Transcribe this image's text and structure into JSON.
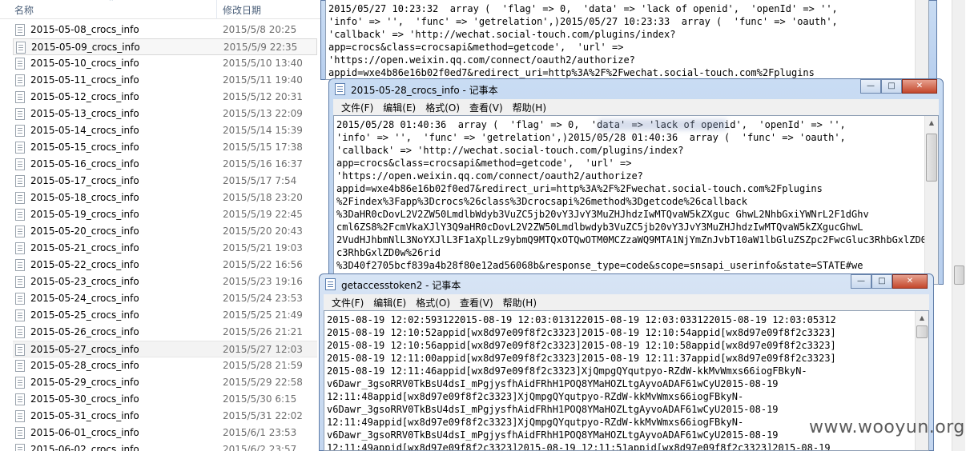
{
  "explorer": {
    "columns": {
      "name": "名称",
      "modified": "修改日期"
    },
    "files": [
      {
        "name": "2015-05-08_crocs_info",
        "date": "2015/5/8 20:25"
      },
      {
        "name": "2015-05-09_crocs_info",
        "date": "2015/5/9 22:35"
      },
      {
        "name": "2015-05-10_crocs_info",
        "date": "2015/5/10 13:40"
      },
      {
        "name": "2015-05-11_crocs_info",
        "date": "2015/5/11 19:40"
      },
      {
        "name": "2015-05-12_crocs_info",
        "date": "2015/5/12 20:31"
      },
      {
        "name": "2015-05-13_crocs_info",
        "date": "2015/5/13 22:09"
      },
      {
        "name": "2015-05-14_crocs_info",
        "date": "2015/5/14 15:39"
      },
      {
        "name": "2015-05-15_crocs_info",
        "date": "2015/5/15 17:38"
      },
      {
        "name": "2015-05-16_crocs_info",
        "date": "2015/5/16 16:37"
      },
      {
        "name": "2015-05-17_crocs_info",
        "date": "2015/5/17 7:54"
      },
      {
        "name": "2015-05-18_crocs_info",
        "date": "2015/5/18 23:20"
      },
      {
        "name": "2015-05-19_crocs_info",
        "date": "2015/5/19 22:45"
      },
      {
        "name": "2015-05-20_crocs_info",
        "date": "2015/5/20 20:43"
      },
      {
        "name": "2015-05-21_crocs_info",
        "date": "2015/5/21 19:03"
      },
      {
        "name": "2015-05-22_crocs_info",
        "date": "2015/5/22 16:56"
      },
      {
        "name": "2015-05-23_crocs_info",
        "date": "2015/5/23 19:16"
      },
      {
        "name": "2015-05-24_crocs_info",
        "date": "2015/5/24 23:53"
      },
      {
        "name": "2015-05-25_crocs_info",
        "date": "2015/5/25 21:49"
      },
      {
        "name": "2015-05-26_crocs_info",
        "date": "2015/5/26 21:21"
      },
      {
        "name": "2015-05-27_crocs_info",
        "date": "2015/5/27 12:03"
      },
      {
        "name": "2015-05-28_crocs_info",
        "date": "2015/5/28 21:59"
      },
      {
        "name": "2015-05-29_crocs_info",
        "date": "2015/5/29 22:58"
      },
      {
        "name": "2015-05-30_crocs_info",
        "date": "2015/5/30 6:15"
      },
      {
        "name": "2015-05-31_crocs_info",
        "date": "2015/5/31 22:02"
      },
      {
        "name": "2015-06-01_crocs_info",
        "date": "2015/6/1 23:53"
      },
      {
        "name": "2015-06-02_crocs_info",
        "date": "2015/6/2 23:57"
      }
    ]
  },
  "notepad_back": {
    "text": "2015/05/27 10:23:32  array (  'flag' => 0,  'data' => 'lack of openid',  'openId' => '',\n'info' => '',  'func' => 'getrelation',)2015/05/27 10:23:33  array (  'func' => 'oauth',\n'callback' => 'http://wechat.social-touch.com/plugins/index?\napp=crocs&class=crocsapi&method=getcode',  'url' =>\n'https://open.weixin.qq.com/connect/oauth2/authorize?\nappid=wxe4b86e16b02f0ed7&redirect_uri=http%3A%2F%2Fwechat.social-touch.com%2Fplugins"
  },
  "notepad_mid": {
    "title": "2015-05-28_crocs_info - 记事本",
    "menus": [
      "文件(F)",
      "编辑(E)",
      "格式(O)",
      "查看(V)",
      "帮助(H)"
    ],
    "text": "2015/05/28 01:40:36  array (  'flag' => 0,  'data' => 'lack of openid',  'openId' => '',\n'info' => '',  'func' => 'getrelation',)2015/05/28 01:40:36  array (  'func' => 'oauth',\n'callback' => 'http://wechat.social-touch.com/plugins/index?\napp=crocs&class=crocsapi&method=getcode',  'url' =>\n'https://open.weixin.qq.com/connect/oauth2/authorize?\nappid=wxe4b86e16b02f0ed7&redirect_uri=http%3A%2F%2Fwechat.social-touch.com%2Fplugins\n%2Findex%3Fapp%3Dcrocs%26class%3Dcrocsapi%26method%3Dgetcode%26callback\n%3DaHR0cDovL2V2ZW50LmdlbWdyb3VuZC5jb20vY3JvY3MuZHJhdzIwMTQvaW5kZXguc GhwL2NhbGxiYWNrL2F1dGhv\ncml6ZS8%2FcmVkaXJlY3Q9aHR0cDovL2V2ZW50Lmdlbwdyb3VuZC5jb20vY3JvY3MuZHJhdzIwMTQvaW5kZXgucGhwL\n2VudHJhbmNlL3NoYXJlL3F1aXplLz9ybmQ9MTQxOTQwOTM0MCZzaWQ9MTA1NjYmZnJvbT10aW1lbGluZSZpc2FwcGluc3RhbGxlZD0w\nc3RhbGxlZD0w%26rid\n%3D40f2705bcf839a4b28f80e12ad56068b&response_type=code&scope=snsapi_userinfo&state=STATE#we"
  },
  "notepad_front": {
    "title": "getaccesstoken2 - 记事本",
    "menus": [
      "文件(F)",
      "编辑(E)",
      "格式(O)",
      "查看(V)",
      "帮助(H)"
    ],
    "text": "2015-08-19 12:02:593122015-08-19 12:03:013122015-08-19 12:03:033122015-08-19 12:03:05312\n2015-08-19 12:10:52appid[wx8d97e09f8f2c3323]2015-08-19 12:10:54appid[wx8d97e09f8f2c3323]\n2015-08-19 12:10:56appid[wx8d97e09f8f2c3323]2015-08-19 12:10:58appid[wx8d97e09f8f2c3323]\n2015-08-19 12:11:00appid[wx8d97e09f8f2c3323]2015-08-19 12:11:37appid[wx8d97e09f8f2c3323]\n2015-08-19 12:11:46appid[wx8d97e09f8f2c3323]XjQmpgQYqutpyo-RZdW-kkMvWmxs66iogFBkyN-\nv6Dawr_3gsoRRV0TkBsU4dsI_mPgjysfhAidFRhH1POQ8YMaHOZLtgAyvoADAF61wCyU2015-08-19\n12:11:48appid[wx8d97e09f8f2c3323]XjQmpgQYqutpyo-RZdW-kkMvWmxs66iogFBkyN-\nv6Dawr_3gsoRRV0TkBsU4dsI_mPgjysfhAidFRhH1POQ8YMaHOZLtgAyvoADAF61wCyU2015-08-19\n12:11:49appid[wx8d97e09f8f2c3323]XjQmpgQYqutpyo-RZdW-kkMvWmxs66iogFBkyN-\nv6Dawr_3gsoRRV0TkBsU4dsI_mPgjysfhAidFRhH1POQ8YMaHOZLtgAyvoADAF61wCyU2015-08-19\n12:11:49appid[wx8d97e09f8f2c3323]2015-08-19 12:11:51appid[wx8d97e09f8f2c3323]2015-08-19"
  },
  "window_buttons": {
    "minimize": "—",
    "maximize": "□",
    "close": "✕"
  },
  "watermark": "www.wooyun.org"
}
